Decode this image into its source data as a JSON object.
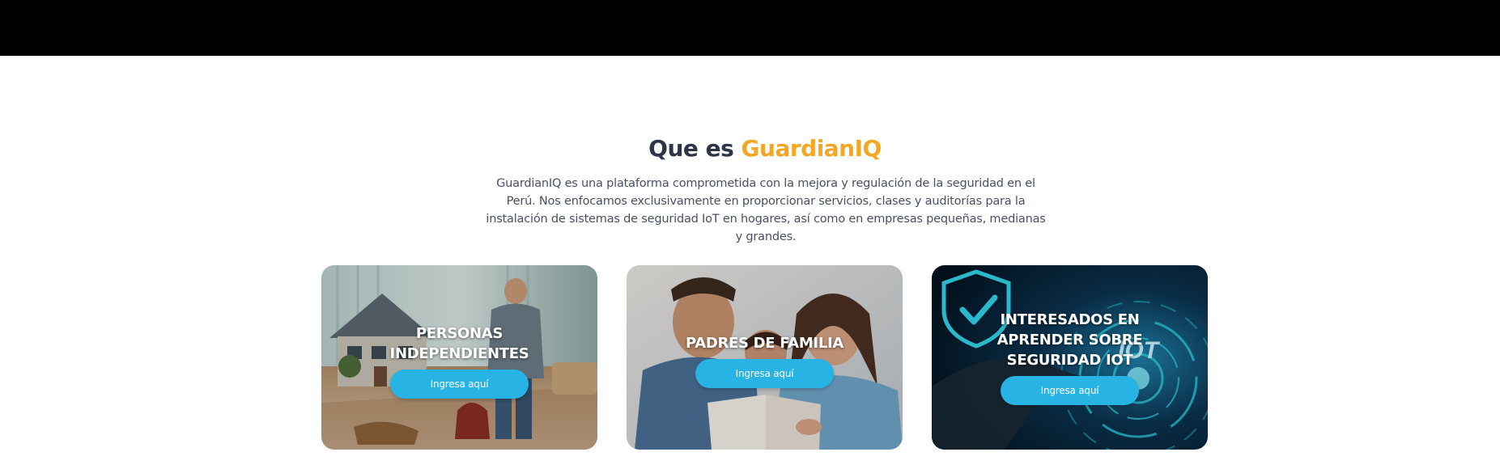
{
  "header": {
    "heading_prefix": "Que es",
    "heading_brand": "GuardianIQ",
    "description": "GuardianIQ es una plataforma comprometida con la mejora y regulación de la seguridad en el Perú. Nos enfocamos exclusivamente en proporcionar servicios, clases y auditorías para la instalación de sistemas de seguridad IoT en hogares, así como en empresas pequeñas, medianas y grandes."
  },
  "cards": [
    {
      "title": "PERSONAS INDEPENDIENTES",
      "button_label": "Ingresa aquí"
    },
    {
      "title": "PADRES DE FAMILIA",
      "button_label": "Ingresa aquí"
    },
    {
      "title": "INTERESADOS EN APRENDER SOBRE SEGURIDAD IOT",
      "button_label": "Ingresa aquí",
      "image_text": "IOT"
    }
  ],
  "colors": {
    "brand": "#f5a623",
    "heading": "#2d3546",
    "button": "#27b3e4",
    "topbar": "#000000"
  }
}
